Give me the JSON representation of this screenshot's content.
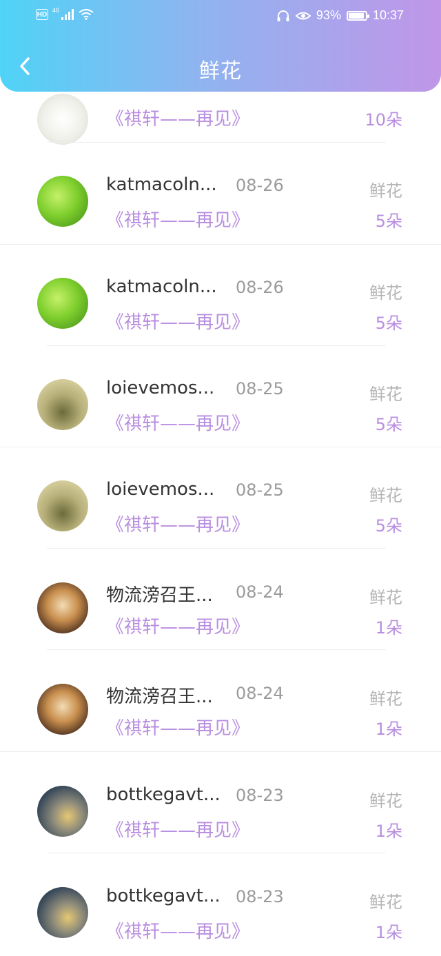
{
  "status_bar": {
    "hd": "HD",
    "network": "46",
    "battery_percent": "93%",
    "battery_level": 0.93,
    "time": "10:37"
  },
  "nav": {
    "title": "鲜花",
    "back_icon": "chevron-left-icon"
  },
  "top_partial": {
    "book": "《祺轩——再见》",
    "count": "10朵"
  },
  "entries": [
    {
      "name": "katmacoln...",
      "date": "08-26",
      "gift": "鲜花",
      "book": "《祺轩——再见》",
      "count": "5朵",
      "avatar": "leaf"
    },
    {
      "name": "katmacoln...",
      "date": "08-26",
      "gift": "鲜花",
      "book": "《祺轩——再见》",
      "count": "5朵",
      "avatar": "leaf"
    },
    {
      "name": "loievemos...",
      "date": "08-25",
      "gift": "鲜花",
      "book": "《祺轩——再见》",
      "count": "5朵",
      "avatar": "tea"
    },
    {
      "name": "loievemos...",
      "date": "08-25",
      "gift": "鲜花",
      "book": "《祺轩——再见》",
      "count": "5朵",
      "avatar": "tea"
    },
    {
      "name": "物流滂召王...",
      "date": "08-24",
      "gift": "鲜花",
      "book": "《祺轩——再见》",
      "count": "1朵",
      "avatar": "skull"
    },
    {
      "name": "物流滂召王...",
      "date": "08-24",
      "gift": "鲜花",
      "book": "《祺轩——再见》",
      "count": "1朵",
      "avatar": "skull"
    },
    {
      "name": "bottkegavt...",
      "date": "08-23",
      "gift": "鲜花",
      "book": "《祺轩——再见》",
      "count": "1朵",
      "avatar": "shoe"
    },
    {
      "name": "bottkegavt...",
      "date": "08-23",
      "gift": "鲜花",
      "book": "《祺轩——再见》",
      "count": "1朵",
      "avatar": "shoe"
    }
  ],
  "colors": {
    "header_start": "#4fd3f6",
    "header_end": "#c096e8",
    "accent_purple": "#b98ee0",
    "name_text": "#333333",
    "meta_text": "#9a9a9a"
  }
}
